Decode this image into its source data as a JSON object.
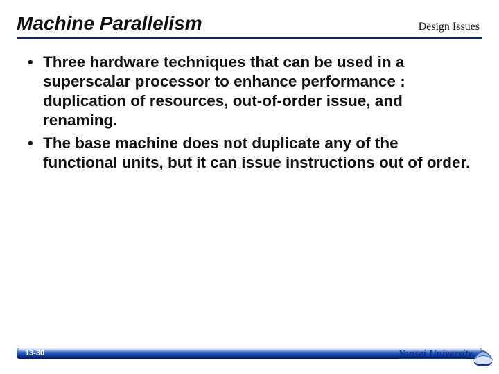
{
  "header": {
    "title": "Machine Parallelism",
    "subtitle": "Design Issues"
  },
  "bullets": [
    "Three hardware techniques that can be used in a superscalar processor to enhance performance : duplication of resources, out-of-order issue, and renaming.",
    "The base machine does not duplicate any of the functional units, but it can issue instructions out of order."
  ],
  "footer": {
    "page": "13-30",
    "university": "Yonsei University"
  }
}
